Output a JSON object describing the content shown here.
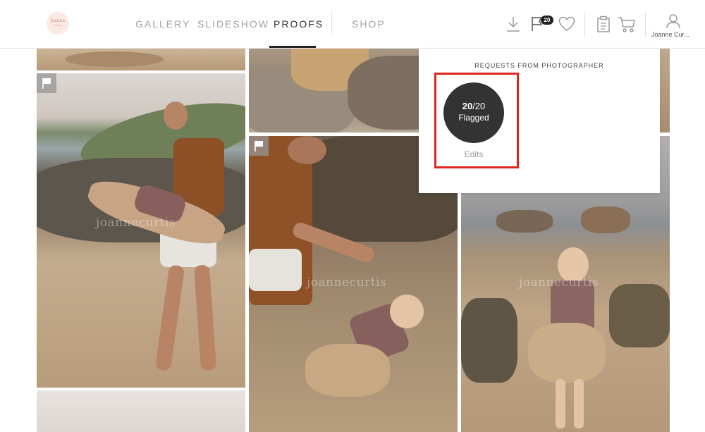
{
  "header": {
    "logo_text": "joanne",
    "logo_sub": "CURTIS",
    "nav": [
      {
        "label": "GALLERY",
        "active": false
      },
      {
        "label": "SLIDESHOW",
        "active": false
      },
      {
        "label": "PROOFS",
        "active": true
      },
      {
        "label": "SHOP",
        "active": false
      }
    ],
    "icons": [
      "download-icon",
      "flag-icon",
      "heart-icon",
      "clipboard-icon",
      "cart-icon",
      "user-icon"
    ],
    "flag_count": "20",
    "user_name": "Joanne Cur..."
  },
  "popup": {
    "title": "REQUESTS FROM PHOTOGRAPHER",
    "flagged_done": "20",
    "flagged_total": "/20",
    "flagged_label": "Flagged",
    "edits_label": "Edits",
    "highlight_color": "#e0241f"
  },
  "gallery": {
    "watermark": "joannecurtis",
    "flagged_icon": "flag-icon"
  },
  "colors": {
    "active_nav": "#333333",
    "inactive_nav": "#a3a3a3",
    "badge": "#222222"
  }
}
